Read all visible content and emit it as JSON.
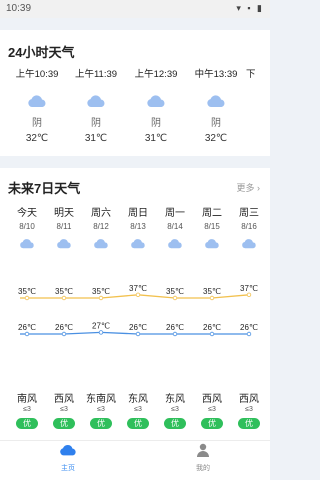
{
  "status": {
    "time": "10:39"
  },
  "hourly": {
    "title": "24小时天气",
    "items": [
      {
        "time": "上午10:39",
        "icon": "cloud-icon",
        "condition": "阴",
        "temp": "32℃"
      },
      {
        "time": "上午11:39",
        "icon": "cloud-icon",
        "condition": "阴",
        "temp": "31℃"
      },
      {
        "time": "上午12:39",
        "icon": "cloud-icon",
        "condition": "阴",
        "temp": "31℃"
      },
      {
        "time": "中午13:39",
        "icon": "cloud-icon",
        "condition": "阴",
        "temp": "32℃"
      },
      {
        "time": "下",
        "icon": "cloud-icon",
        "condition": "",
        "temp": ""
      }
    ]
  },
  "daily": {
    "title": "未来7日天气",
    "more": "更多",
    "days": [
      {
        "name": "今天",
        "date": "8/10",
        "icon": "cloud-icon",
        "high": 35,
        "high_label": "35℃",
        "low": 26,
        "low_label": "26℃",
        "wind": "南风",
        "level": "≤3",
        "aqi": "优"
      },
      {
        "name": "明天",
        "date": "8/11",
        "icon": "cloud-icon",
        "high": 35,
        "high_label": "35℃",
        "low": 26,
        "low_label": "26℃",
        "wind": "西风",
        "level": "≤3",
        "aqi": "优"
      },
      {
        "name": "周六",
        "date": "8/12",
        "icon": "cloud-icon",
        "high": 35,
        "high_label": "35℃",
        "low": 27,
        "low_label": "27℃",
        "wind": "东南风",
        "level": "≤3",
        "aqi": "优"
      },
      {
        "name": "周日",
        "date": "8/13",
        "icon": "cloud-icon",
        "high": 37,
        "high_label": "37℃",
        "low": 26,
        "low_label": "26℃",
        "wind": "东风",
        "level": "≤3",
        "aqi": "优"
      },
      {
        "name": "周一",
        "date": "8/14",
        "icon": "cloud-icon",
        "high": 35,
        "high_label": "35℃",
        "low": 26,
        "low_label": "26℃",
        "wind": "东风",
        "level": "≤3",
        "aqi": "优"
      },
      {
        "name": "周二",
        "date": "8/15",
        "icon": "cloud-icon",
        "high": 35,
        "high_label": "35℃",
        "low": 26,
        "low_label": "26℃",
        "wind": "西风",
        "level": "≤3",
        "aqi": "优"
      },
      {
        "name": "周三",
        "date": "8/16",
        "icon": "cloud-icon",
        "high": 37,
        "high_label": "37℃",
        "low": 26,
        "low_label": "26℃",
        "wind": "西风",
        "level": "≤3",
        "aqi": "优"
      }
    ]
  },
  "nav": {
    "home": {
      "label": "主页",
      "icon": "cloud-icon"
    },
    "me": {
      "label": "我的",
      "icon": "person-icon"
    }
  },
  "colors": {
    "high_line": "#f2c14e",
    "low_line": "#4a90e2",
    "cloud": "#9dbff0",
    "aqi_good": "#2fbf5b",
    "accent": "#3d8ef0"
  }
}
